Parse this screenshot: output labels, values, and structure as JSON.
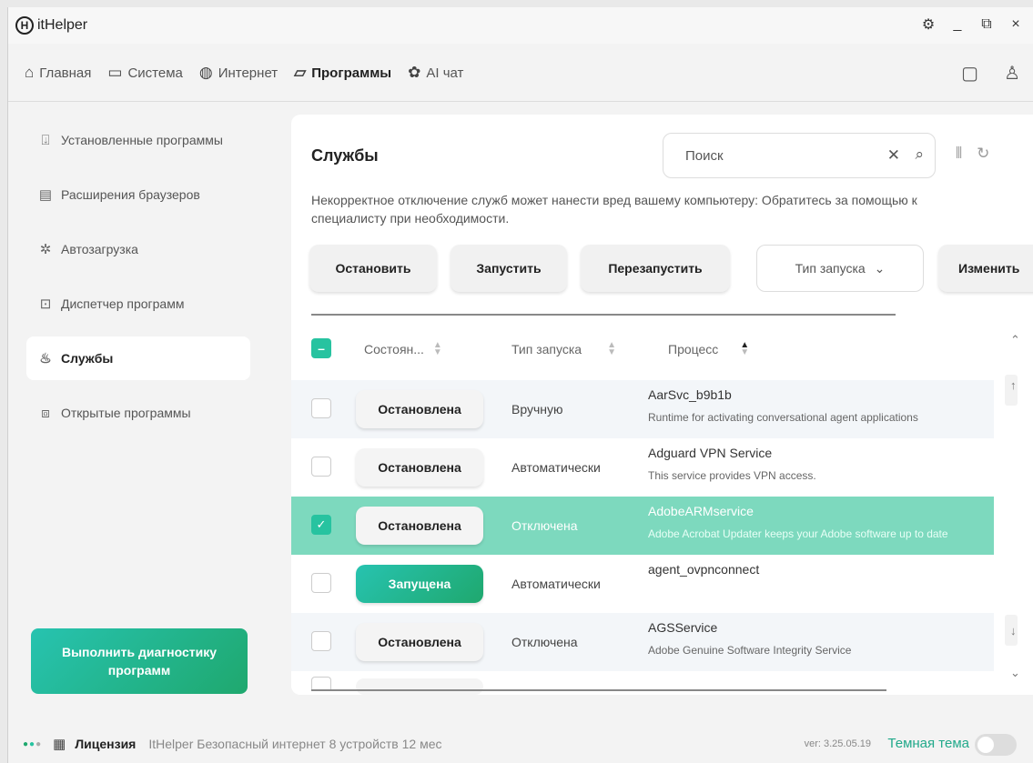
{
  "app": {
    "logo_letter": "H",
    "name": "itHelper"
  },
  "window_controls": {
    "settings_icon": "gear-icon",
    "minimize": "_",
    "popout_icon": "popout-icon",
    "close": "×"
  },
  "nav": {
    "items": [
      {
        "label": "Главная",
        "icon": "home-icon"
      },
      {
        "label": "Система",
        "icon": "monitor-icon"
      },
      {
        "label": "Интернет",
        "icon": "globe-icon"
      },
      {
        "label": "Программы",
        "icon": "folder-icon",
        "active": true
      },
      {
        "label": "AI чат",
        "icon": "ai-icon"
      }
    ]
  },
  "sidebar": {
    "items": [
      {
        "label": "Установленные программы",
        "icon": "install-icon"
      },
      {
        "label": "Расширения браузеров",
        "icon": "browser-ext-icon"
      },
      {
        "label": "Автозагрузка",
        "icon": "autostart-icon"
      },
      {
        "label": "Диспетчер программ",
        "icon": "task-manager-icon"
      },
      {
        "label": "Службы",
        "icon": "services-icon",
        "active": true
      },
      {
        "label": "Открытые программы",
        "icon": "open-programs-icon"
      }
    ],
    "diagnostics_button": "Выполнить диагностику программ"
  },
  "panel": {
    "title": "Службы",
    "search_placeholder": "Поиск",
    "warning": "Некорректное отключение служб может нанести вред вашему компьютеру: Обратитесь за помощью к специалисту при необходимости.",
    "actions": {
      "stop": "Остановить",
      "start": "Запустить",
      "restart": "Перезапустить",
      "startup_type": "Тип запуска",
      "change": "Изменить"
    },
    "columns": {
      "state": "Состоян...",
      "startup_type": "Тип запуска",
      "process": "Процесс"
    },
    "rows": [
      {
        "checked": false,
        "state": "Остановлена",
        "running": false,
        "type": "Вручную",
        "name": "AarSvc_b9b1b",
        "desc": "Runtime for activating conversational agent applications"
      },
      {
        "checked": false,
        "state": "Остановлена",
        "running": false,
        "type": "Автоматически",
        "name": "Adguard VPN Service",
        "desc": "This service provides VPN access."
      },
      {
        "checked": true,
        "state": "Остановлена",
        "running": false,
        "type": "Отключена",
        "name": "AdobeARMservice",
        "desc": "Adobe Acrobat Updater keeps your Adobe software up to date"
      },
      {
        "checked": false,
        "state": "Запущена",
        "running": true,
        "type": "Автоматически",
        "name": "agent_ovpnconnect",
        "desc": ""
      },
      {
        "checked": false,
        "state": "Остановлена",
        "running": false,
        "type": "Отключена",
        "name": "AGSService",
        "desc": "Adobe Genuine Software Integrity Service"
      }
    ]
  },
  "footer": {
    "license_label": "Лицензия",
    "license_text": "ItHelper Безопасный интернет 8 устройств 12 мес",
    "version": "ver: 3.25.05.19",
    "theme_label": "Темная тема",
    "dark_theme_on": false
  }
}
